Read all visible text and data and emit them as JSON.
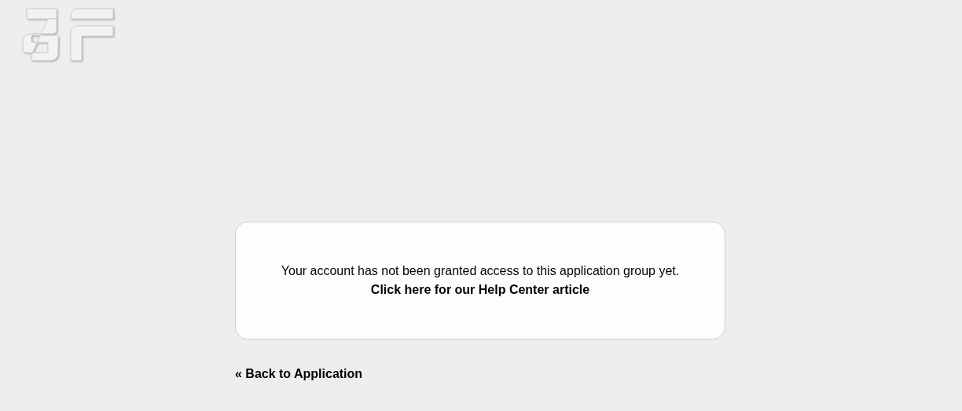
{
  "message": {
    "text": "Your account has not been granted access to this application group yet.",
    "link": "Click here for our Help Center article"
  },
  "back_link": "« Back to Application"
}
